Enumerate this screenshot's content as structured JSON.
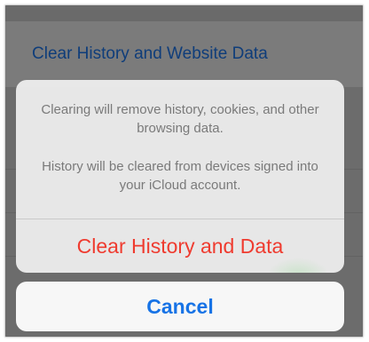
{
  "background": {
    "row_label": "Clear History and Website Data"
  },
  "alert": {
    "message_line1": "Clearing will remove history, cookies, and other browsing data.",
    "message_line2": "History will be cleared from devices signed into your iCloud account.",
    "destructive_label": "Clear History and Data",
    "destructive_color": "#ef3b2f"
  },
  "cancel": {
    "label": "Cancel",
    "color": "#1773e6"
  }
}
